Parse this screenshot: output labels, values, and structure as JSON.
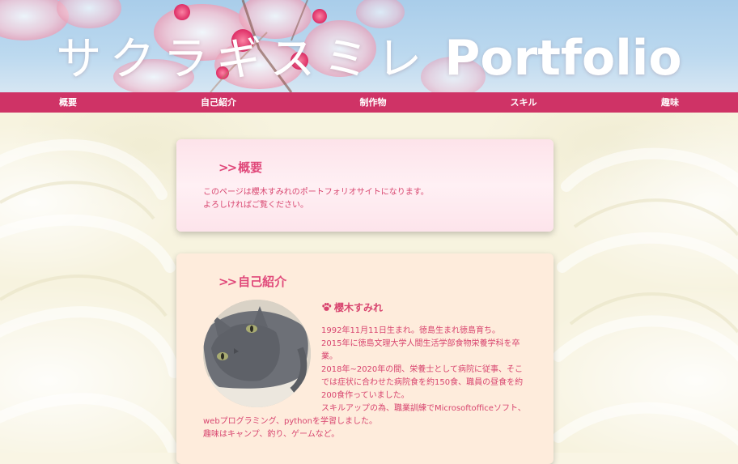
{
  "header": {
    "title_jp": "サクラギスミレ",
    "title_en": "Portfolio"
  },
  "nav": {
    "items": [
      {
        "label": "概要"
      },
      {
        "label": "自己紹介"
      },
      {
        "label": "制作物"
      },
      {
        "label": "スキル"
      },
      {
        "label": "趣味"
      }
    ]
  },
  "overview": {
    "heading_marker": ">>",
    "heading": "概要",
    "text_line1": "このページは櫻木すみれのポートフォリオサイトになります。",
    "text_line2": "よろしければご覧ください。"
  },
  "intro": {
    "heading_marker": ">>",
    "heading": "自己紹介",
    "name_icon": "paw-icon",
    "name": "櫻木すみれ",
    "photo": "cat-photo",
    "bio": [
      "1992年11月11日生まれ。徳島生まれ徳島育ち。",
      "2015年に徳島文理大学人間生活学部食物栄養学科を卒業。",
      "2018年~2020年の間、栄養士として病院に従事、そこでは症状に合わせた病院食を約150食、職員の昼食を約200食作っていました。",
      "スキルアップの為、職業訓練でMicrosoftofficeソフト、webプログラミング、pythonを学習しました。",
      "趣味はキャンプ、釣り、ゲームなど。"
    ]
  },
  "colors": {
    "nav_bg": "#cf3366",
    "accent_text": "#d8456f",
    "heading": "#e0487a",
    "page_bg": "#f7f3df"
  }
}
